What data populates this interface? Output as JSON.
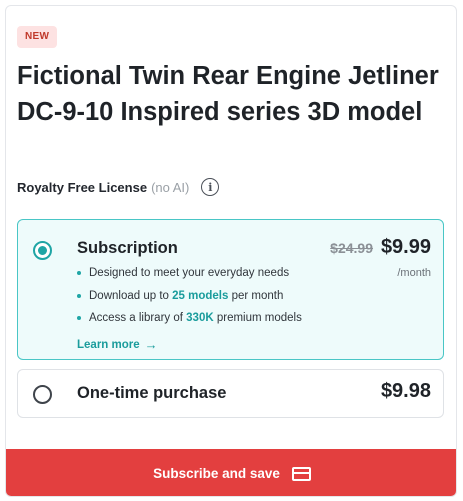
{
  "badge": "NEW",
  "title": "Fictional Twin Rear Engine Jetliner DC-9-10 Inspired series 3D model",
  "license": {
    "name": "Royalty Free License",
    "note": "(no AI)",
    "info_icon": "info-icon"
  },
  "subscription": {
    "label": "Subscription",
    "selected": true,
    "old_price": "$24.99",
    "price": "$9.99",
    "period": "/month",
    "features": [
      {
        "text": "Designed to meet your everyday needs"
      },
      {
        "before": "Download up to ",
        "highlight": "25 models",
        "after": " per month"
      },
      {
        "before": "Access a library of ",
        "highlight": "330K",
        "after": " premium models"
      }
    ],
    "learn_more": "Learn more",
    "accent_color": "#1fa5a5"
  },
  "one_time": {
    "label": "One-time purchase",
    "price": "$9.98",
    "selected": false
  },
  "cta": {
    "label": "Subscribe and save",
    "icon": "credit-card-icon",
    "color": "#e33f3f"
  }
}
